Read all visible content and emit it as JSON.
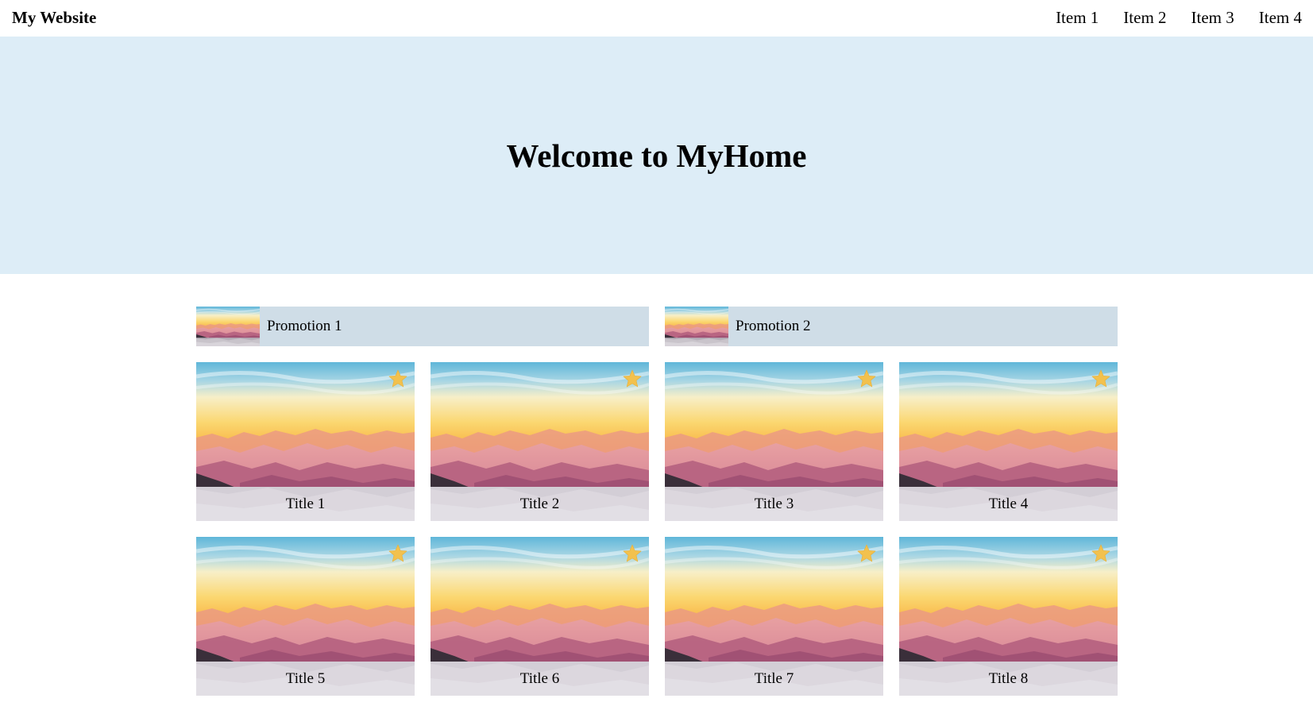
{
  "navbar": {
    "brand": "My Website",
    "items": [
      {
        "label": "Item 1"
      },
      {
        "label": "Item 2"
      },
      {
        "label": "Item 3"
      },
      {
        "label": "Item 4"
      }
    ]
  },
  "hero": {
    "title": "Welcome to MyHome",
    "background": "#ddedf7"
  },
  "promotions": [
    {
      "label": "Promotion 1"
    },
    {
      "label": "Promotion 2"
    }
  ],
  "cards": [
    {
      "title": "Title 1",
      "icon": "star-icon"
    },
    {
      "title": "Title 2",
      "icon": "star-icon"
    },
    {
      "title": "Title 3",
      "icon": "star-icon"
    },
    {
      "title": "Title 4",
      "icon": "star-icon"
    },
    {
      "title": "Title 5",
      "icon": "star-icon"
    },
    {
      "title": "Title 6",
      "icon": "star-icon"
    },
    {
      "title": "Title 7",
      "icon": "star-icon"
    },
    {
      "title": "Title 8",
      "icon": "star-icon"
    }
  ],
  "colors": {
    "promo_background": "#cfdde7",
    "star": "#f2c14e"
  }
}
